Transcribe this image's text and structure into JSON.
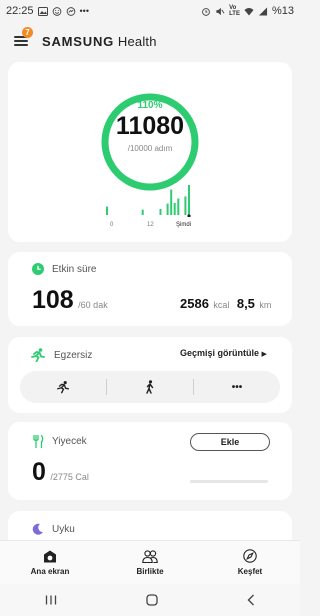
{
  "status": {
    "time": "22:25",
    "battery": "%13"
  },
  "header": {
    "brand_samsung": "SAMSUNG",
    "brand_health": "Health",
    "badge_count": "7"
  },
  "steps": {
    "percent": "110%",
    "count": "11080",
    "goal": "/10000 adım",
    "progress_fraction": 1.0,
    "axis_labels": [
      "0",
      "12",
      "Şimdi"
    ],
    "hourly_bars": [
      0.28,
      0,
      0,
      0,
      0,
      0,
      0,
      0,
      0,
      0,
      0.18,
      0,
      0,
      0,
      0,
      0.2,
      0,
      0.38,
      0.85,
      0.4,
      0.55,
      0,
      0.62,
      1.0
    ],
    "accent": "#2ecc71"
  },
  "active_time": {
    "title": "Etkin süre",
    "minutes": "108",
    "goal": "/60 dak",
    "kcal_value": "2586",
    "kcal_unit": "kcal",
    "km_value": "8,5",
    "km_unit": "km",
    "accent": "#2ecc71"
  },
  "exercise": {
    "title": "Egzersiz",
    "history_link": "Geçmişi görüntüle",
    "buttons": [
      "run-icon",
      "walk-icon",
      "more-icon"
    ],
    "more_label": "•••"
  },
  "food": {
    "title": "Yiyecek",
    "add_label": "Ekle",
    "calories": "0",
    "goal": "/2775 Cal"
  },
  "sleep": {
    "title": "Uyku"
  },
  "nav": {
    "items": [
      {
        "label": "Ana ekran",
        "icon": "home-icon"
      },
      {
        "label": "Birlikte",
        "icon": "people-icon"
      },
      {
        "label": "Keşfet",
        "icon": "compass-icon"
      }
    ]
  }
}
